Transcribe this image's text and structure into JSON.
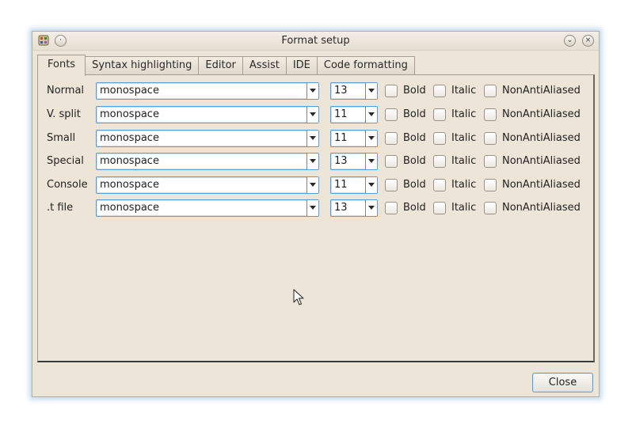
{
  "window": {
    "title": "Format setup",
    "minimize_glyph": "⌄",
    "close_glyph": "×",
    "menu_glyph": "·"
  },
  "tabs": [
    {
      "label": "Fonts",
      "active": true
    },
    {
      "label": "Syntax highlighting",
      "active": false
    },
    {
      "label": "Editor",
      "active": false
    },
    {
      "label": "Assist",
      "active": false
    },
    {
      "label": "IDE",
      "active": false
    },
    {
      "label": "Code formatting",
      "active": false
    }
  ],
  "checkbox_labels": {
    "bold": "Bold",
    "italic": "Italic",
    "nonantialiased": "NonAntiAliased"
  },
  "fonts": {
    "rows": [
      {
        "label": "Normal",
        "font": "monospace",
        "size": "13",
        "bold": false,
        "italic": false,
        "nonantialiased": false
      },
      {
        "label": "V. split",
        "font": "monospace",
        "size": "11",
        "bold": false,
        "italic": false,
        "nonantialiased": false
      },
      {
        "label": "Small",
        "font": "monospace",
        "size": "11",
        "bold": false,
        "italic": false,
        "nonantialiased": false
      },
      {
        "label": "Special",
        "font": "monospace",
        "size": "13",
        "bold": false,
        "italic": false,
        "nonantialiased": false
      },
      {
        "label": "Console",
        "font": "monospace",
        "size": "11",
        "bold": false,
        "italic": false,
        "nonantialiased": false
      },
      {
        "label": ".t file",
        "font": "monospace",
        "size": "13",
        "bold": false,
        "italic": false,
        "nonantialiased": false
      }
    ]
  },
  "buttons": {
    "close": "Close"
  },
  "colors": {
    "dialog_bg": "#ede5d8",
    "focus_border": "#5d9bd0",
    "glow": "#6eaadc"
  }
}
